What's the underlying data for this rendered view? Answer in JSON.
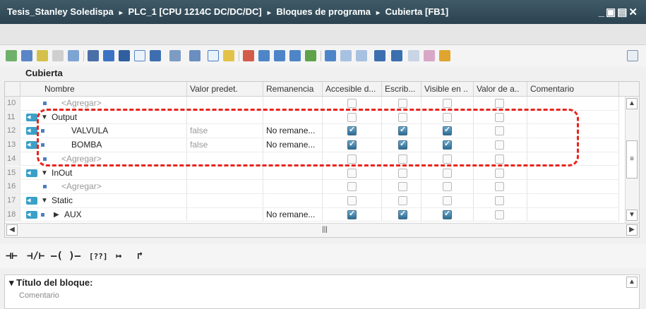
{
  "breadcrumb": [
    "Tesis_Stanley Soledispa",
    "PLC_1 [CPU 1214C DC/DC/DC]",
    "Bloques de programa",
    "Cubierta [FB1]"
  ],
  "block_name": "Cubierta",
  "columns": [
    "Nombre",
    "Valor predet.",
    "Remanencia",
    "Accesible d...",
    "Escrib...",
    "Visible en ..",
    "Valor de a..",
    "Comentario"
  ],
  "rows": [
    {
      "num": "10",
      "type": "add",
      "name": "<Agregar>",
      "default": "",
      "retain": "",
      "checks": [
        0,
        0,
        0,
        0
      ]
    },
    {
      "num": "11",
      "type": "section",
      "name": "Output",
      "default": "",
      "retain": "",
      "checks": [
        0,
        0,
        0,
        0
      ]
    },
    {
      "num": "12",
      "type": "var",
      "name": "VALVULA",
      "default": "false",
      "retain": "No remane...",
      "checks": [
        1,
        1,
        1,
        0
      ]
    },
    {
      "num": "13",
      "type": "var",
      "name": "BOMBA",
      "default": "false",
      "retain": "No remane...",
      "checks": [
        1,
        1,
        1,
        0
      ]
    },
    {
      "num": "14",
      "type": "add",
      "name": "<Agregar>",
      "default": "",
      "retain": "",
      "checks": [
        0,
        0,
        0,
        0
      ]
    },
    {
      "num": "15",
      "type": "section",
      "name": "InOut",
      "default": "",
      "retain": "",
      "checks": [
        0,
        0,
        0,
        0
      ]
    },
    {
      "num": "16",
      "type": "add",
      "name": "<Agregar>",
      "default": "",
      "retain": "",
      "checks": [
        0,
        0,
        0,
        0
      ]
    },
    {
      "num": "17",
      "type": "section",
      "name": "Static",
      "default": "",
      "retain": "",
      "checks": [
        0,
        0,
        0,
        0
      ]
    },
    {
      "num": "18",
      "type": "struct",
      "name": "AUX",
      "default": "",
      "retain": "No remane...",
      "checks": [
        1,
        1,
        1,
        0
      ]
    }
  ],
  "ladder_symbols": [
    "⊣⊢",
    "⊣/⊢",
    "–( )–",
    "[??]",
    "↦",
    "↱"
  ],
  "block_title": {
    "label": "Título del bloque:",
    "comment": "Comentario"
  },
  "colors": {
    "highlight": "#e8241c",
    "title_bar": "#2f4753",
    "checkbox_on": "#2f6b93"
  }
}
